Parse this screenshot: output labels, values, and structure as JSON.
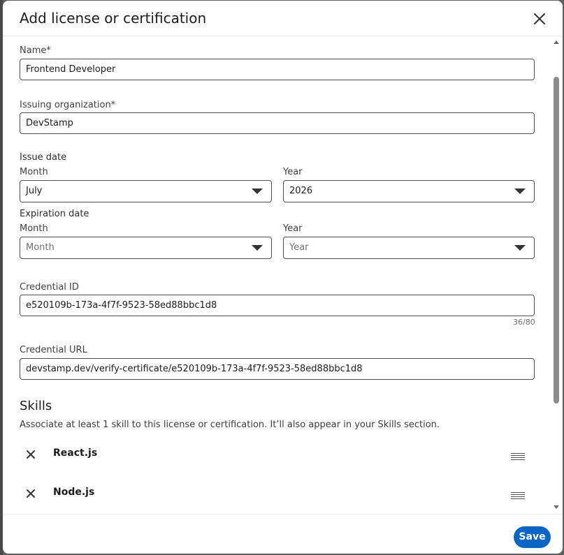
{
  "dialog": {
    "title": "Add license or certification"
  },
  "form": {
    "name": {
      "label": "Name*",
      "value": "Frontend Developer"
    },
    "issuing_org": {
      "label": "Issuing organization*",
      "value": "DevStamp"
    },
    "issue_date": {
      "label": "Issue date",
      "month_label": "Month",
      "month_value": "July",
      "year_label": "Year",
      "year_value": "2026"
    },
    "expiration_date": {
      "label": "Expiration date",
      "month_label": "Month",
      "month_placeholder": "Month",
      "year_label": "Year",
      "year_placeholder": "Year"
    },
    "credential_id": {
      "label": "Credential ID",
      "value": "e520109b-173a-4f7f-9523-58ed88bbc1d8",
      "counter": "36/80"
    },
    "credential_url": {
      "label": "Credential URL",
      "value": "devstamp.dev/verify-certificate/e520109b-173a-4f7f-9523-58ed88bbc1d8"
    }
  },
  "skills": {
    "title": "Skills",
    "description": "Associate at least 1 skill to this license or certification. It’ll also appear in your Skills section.",
    "items": [
      {
        "name": "React.js"
      },
      {
        "name": "Node.js"
      }
    ]
  },
  "footer": {
    "save_label": "Save"
  },
  "icons": {
    "close": "close-icon",
    "remove": "close-icon",
    "drag": "drag-handle-icon",
    "dropdown": "chevron-down-icon"
  },
  "colors": {
    "primary": "#0a66c2",
    "border": "#4d4d4d",
    "text": "#191919",
    "backdrop": "#5f5f5f"
  }
}
